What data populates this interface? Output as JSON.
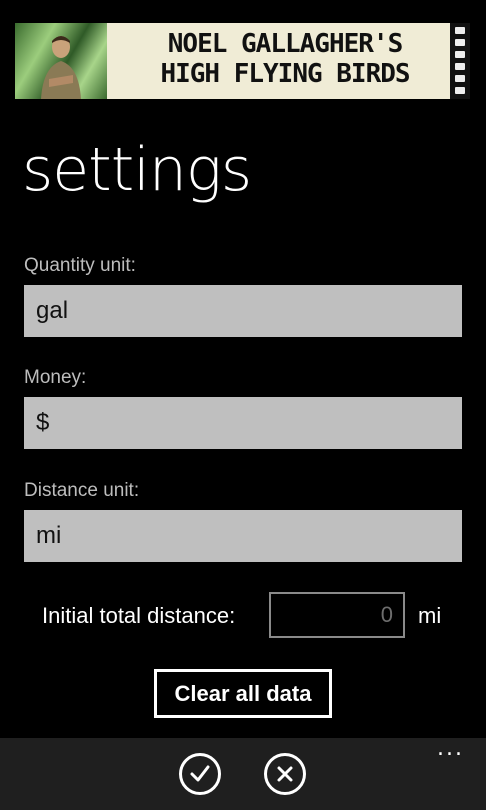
{
  "banner": {
    "line1": "NOEL GALLAGHER'S",
    "line2": "HIGH FLYING BIRDS"
  },
  "page": {
    "title": "settings"
  },
  "form": {
    "quantity_label": "Quantity unit:",
    "quantity_value": "gal",
    "money_label": "Money:",
    "money_value": "$",
    "distance_label": "Distance unit:",
    "distance_value": "mi",
    "initial_distance_label": "Initial total distance:",
    "initial_distance_value": "0",
    "initial_distance_unit": "mi",
    "clear_label": "Clear all data"
  },
  "appbar": {
    "more": "..."
  },
  "colors": {
    "background": "#000000",
    "field": "#bfbfbf",
    "appbar": "#1f1f1f"
  }
}
